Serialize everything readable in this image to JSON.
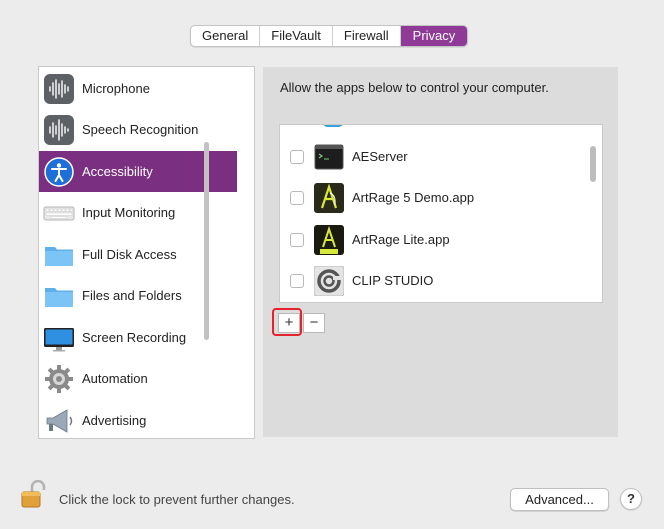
{
  "tabs": [
    {
      "label": "General"
    },
    {
      "label": "FileVault"
    },
    {
      "label": "Firewall"
    },
    {
      "label": "Privacy",
      "active": true
    }
  ],
  "sidebar": {
    "items": [
      {
        "label": "Microphone",
        "icon": "microphone-waveform-icon"
      },
      {
        "label": "Speech Recognition",
        "icon": "speech-waveform-icon"
      },
      {
        "label": "Accessibility",
        "icon": "accessibility-icon",
        "selected": true
      },
      {
        "label": "Input Monitoring",
        "icon": "keyboard-icon"
      },
      {
        "label": "Full Disk Access",
        "icon": "folder-icon"
      },
      {
        "label": "Files and Folders",
        "icon": "folder-icon"
      },
      {
        "label": "Screen Recording",
        "icon": "display-icon"
      },
      {
        "label": "Automation",
        "icon": "gear-icon"
      },
      {
        "label": "Advertising",
        "icon": "megaphone-icon"
      }
    ]
  },
  "panel": {
    "title": "Allow the apps below to control your computer.",
    "apps": [
      {
        "name": "AEServer",
        "checked": false,
        "icon": "terminal-icon"
      },
      {
        "name": "ArtRage 5 Demo.app",
        "checked": false,
        "icon": "artrage-icon"
      },
      {
        "name": "ArtRage Lite.app",
        "checked": false,
        "icon": "artrage-lite-icon"
      },
      {
        "name": "CLIP STUDIO",
        "checked": false,
        "icon": "clip-studio-icon"
      }
    ],
    "add_label": "+",
    "remove_label": "−"
  },
  "footer": {
    "lock_text": "Click the lock to prevent further changes.",
    "advanced_label": "Advanced...",
    "help_label": "?"
  },
  "colors": {
    "accent": "#8f3a97",
    "selection": "#7b2f80",
    "highlight": "#e3242b"
  }
}
